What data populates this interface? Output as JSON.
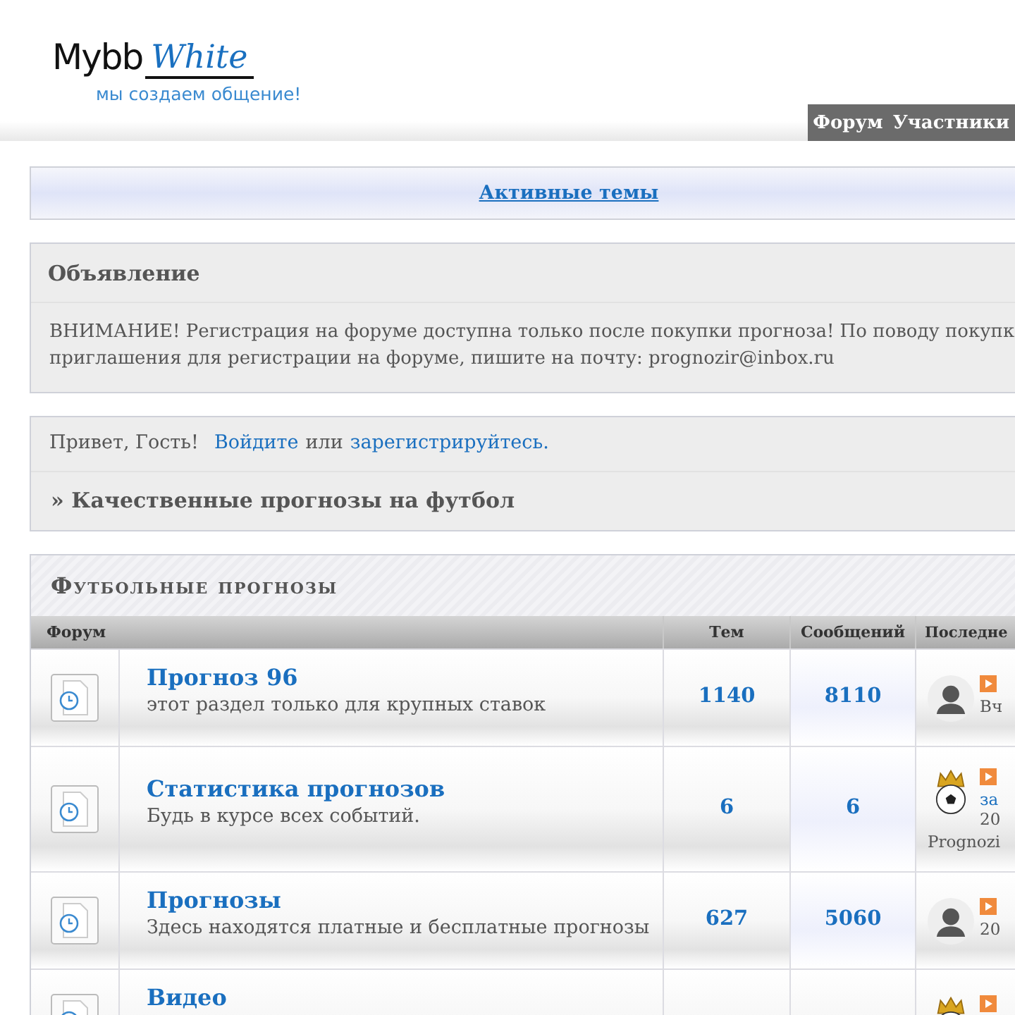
{
  "logo": {
    "name": "Mybb",
    "accent": "White",
    "tagline": "мы создаем общение!"
  },
  "nav": [
    {
      "label": "Форум"
    },
    {
      "label": "Участники"
    }
  ],
  "active_topics": "Активные темы",
  "announcement": {
    "title": "Объявление",
    "text": "ВНИМАНИЕ! Регистрация на форуме доступна только после покупки прогноза! По поводу покупк",
    "text_2": "приглашения для регистрации на форуме, пишите на почту: prognozir@inbox.ru"
  },
  "welcome": {
    "greeting": "Привет, Гость!",
    "login": "Войдите",
    "or": "или",
    "register": "зарегистрируйтесь."
  },
  "breadcrumb": "» Качественные прогнозы на футбол",
  "category": {
    "title": "Футбольные прогнозы",
    "columns": [
      "Форум",
      "Тем",
      "Сообщений",
      "Последне"
    ],
    "rows": [
      {
        "name": "Прогноз 96",
        "description": "этот раздел только для крупных ставок",
        "topics": "1140",
        "posts": "8110",
        "avatar": {
          "kind": "silhouette"
        },
        "last": [
          {
            "kind": "text",
            "text": "Вч"
          }
        ]
      },
      {
        "name": "Статистика прогнозов",
        "description": "Будь в курсе всех событий.",
        "topics": "6",
        "posts": "6",
        "avatar": {
          "kind": "ball"
        },
        "last": [
          {
            "kind": "link",
            "text": "за"
          },
          {
            "kind": "text",
            "text": "20"
          }
        ],
        "last_author": "Prognozi"
      },
      {
        "name": "Прогнозы",
        "description": "Здесь находятся платные и бесплатные прогнозы",
        "topics": "627",
        "posts": "5060",
        "avatar": {
          "kind": "silhouette"
        },
        "last": [
          {
            "kind": "text",
            "text": "20"
          }
        ]
      },
      {
        "name": "Видео",
        "avatar": {
          "kind": "ball"
        },
        "last": []
      }
    ]
  }
}
